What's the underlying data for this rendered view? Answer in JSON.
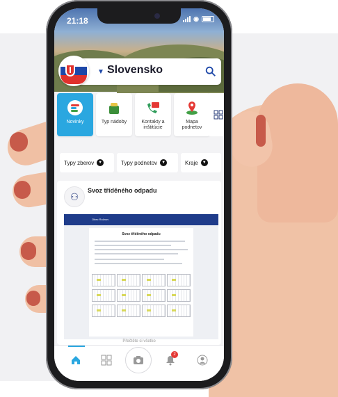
{
  "status_bar": {
    "time": "21:18"
  },
  "header": {
    "region": "Slovensko"
  },
  "tiles": [
    {
      "label": "Novinky",
      "active": true,
      "icon": "news-icon"
    },
    {
      "label": "Typ nádoby",
      "active": false,
      "icon": "bin-icon"
    },
    {
      "label": "Kontakty a inštitúcie",
      "active": false,
      "icon": "phone-icon"
    },
    {
      "label": "Mapa podnetov",
      "active": false,
      "icon": "map-pin-icon"
    }
  ],
  "filters": [
    {
      "label": "Typy zberov"
    },
    {
      "label": "Typy podnetov"
    },
    {
      "label": "Kraje"
    }
  ],
  "post": {
    "title": "Svoz tříděného odpadu",
    "subtitle": "",
    "date": "",
    "doc_header_org": "Obec Rožnov",
    "doc_heading": "Svoz tříděného odpadu",
    "more_link": "Přečtěte si všetko"
  },
  "bottom_nav": {
    "items": [
      "home-icon",
      "grid-icon",
      "camera-icon",
      "bell-icon",
      "user-icon"
    ],
    "notification_count": "2"
  },
  "colors": {
    "accent": "#2aa7e0",
    "brand": "#1d47a8",
    "badge": "#e53935"
  }
}
